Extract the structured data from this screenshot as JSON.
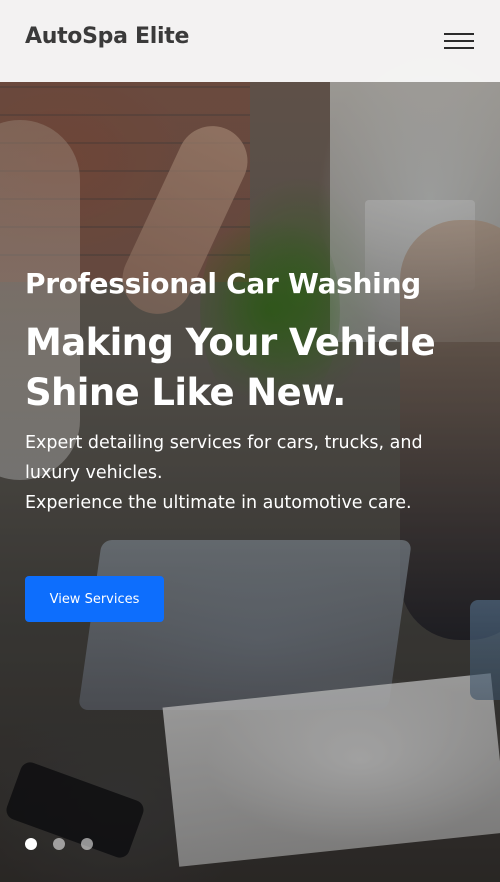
{
  "header": {
    "brand": "AutoSpa Elite",
    "menu_icon": "hamburger-menu-icon"
  },
  "hero": {
    "eyebrow": "Professional Car Washing",
    "headline_line1": "Making Your Vehicle",
    "headline_line2": "Shine Like New.",
    "description_line1": "Expert detailing services for cars, trucks, and",
    "description_line2": "luxury vehicles.",
    "description_line3": "Experience the ultimate in automotive care.",
    "cta_label": "View Services",
    "cta_color": "#0d6efd"
  },
  "carousel": {
    "slide_count": 3,
    "active_index": 0
  }
}
